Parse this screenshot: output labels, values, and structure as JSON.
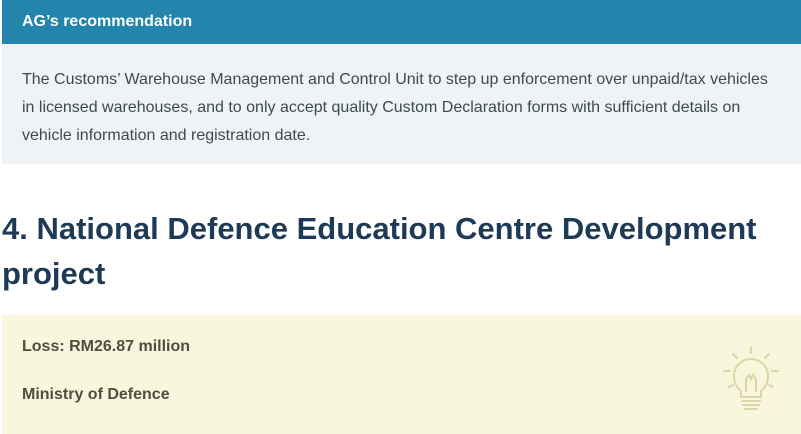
{
  "recommendation": {
    "heading": "AG’s recommendation",
    "body": "The Customs’ Warehouse Management and Control Unit to step up enforcement over unpaid/tax vehicles in licensed warehouses, and to only accept quality Custom Declaration forms with sufficient details on vehicle information and registration date."
  },
  "section": {
    "title": "4. National Defence Education Centre Development project"
  },
  "loss_box": {
    "loss": "Loss: RM26.87 million",
    "ministry": "Ministry of Defence",
    "icon": "lightbulb-icon"
  },
  "colors": {
    "header_bg": "#2385ab",
    "rec_bg": "#eff3f5",
    "title": "#1f3a56",
    "loss_bg": "#f8f6dd"
  }
}
